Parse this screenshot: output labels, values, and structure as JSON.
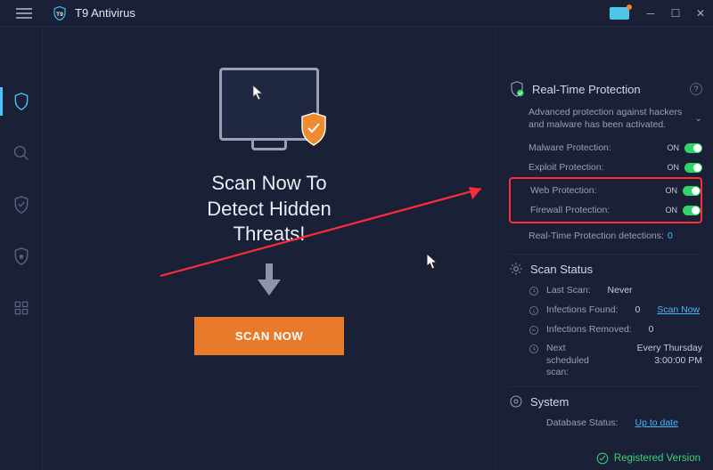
{
  "app": {
    "title": "T9 Antivirus"
  },
  "center": {
    "heading_l1": "Scan Now To",
    "heading_l2": "Detect Hidden",
    "heading_l3": "Threats!",
    "scan_button": "SCAN NOW"
  },
  "rtp": {
    "title": "Real-Time Protection",
    "desc": "Advanced protection against hackers and malware has been activated.",
    "rows": {
      "malware": {
        "label": "Malware Protection:",
        "state": "ON"
      },
      "exploit": {
        "label": "Exploit Protection:",
        "state": "ON"
      },
      "web": {
        "label": "Web Protection:",
        "state": "ON"
      },
      "firewall": {
        "label": "Firewall Protection:",
        "state": "ON"
      }
    },
    "detections_label": "Real-Time Protection detections:",
    "detections_count": "0"
  },
  "scan_status": {
    "title": "Scan Status",
    "last_scan_label": "Last Scan:",
    "last_scan_value": "Never",
    "infections_found_label": "Infections Found:",
    "infections_found_value": "0",
    "scan_now_link": "Scan Now",
    "infections_removed_label": "Infections Removed:",
    "infections_removed_value": "0",
    "next_scan_label": "Next scheduled scan:",
    "next_scan_value": "Every Thursday 3:00:00 PM"
  },
  "system": {
    "title": "System",
    "db_label": "Database Status:",
    "db_value": "Up to date"
  },
  "footer": {
    "registered": "Registered Version"
  }
}
